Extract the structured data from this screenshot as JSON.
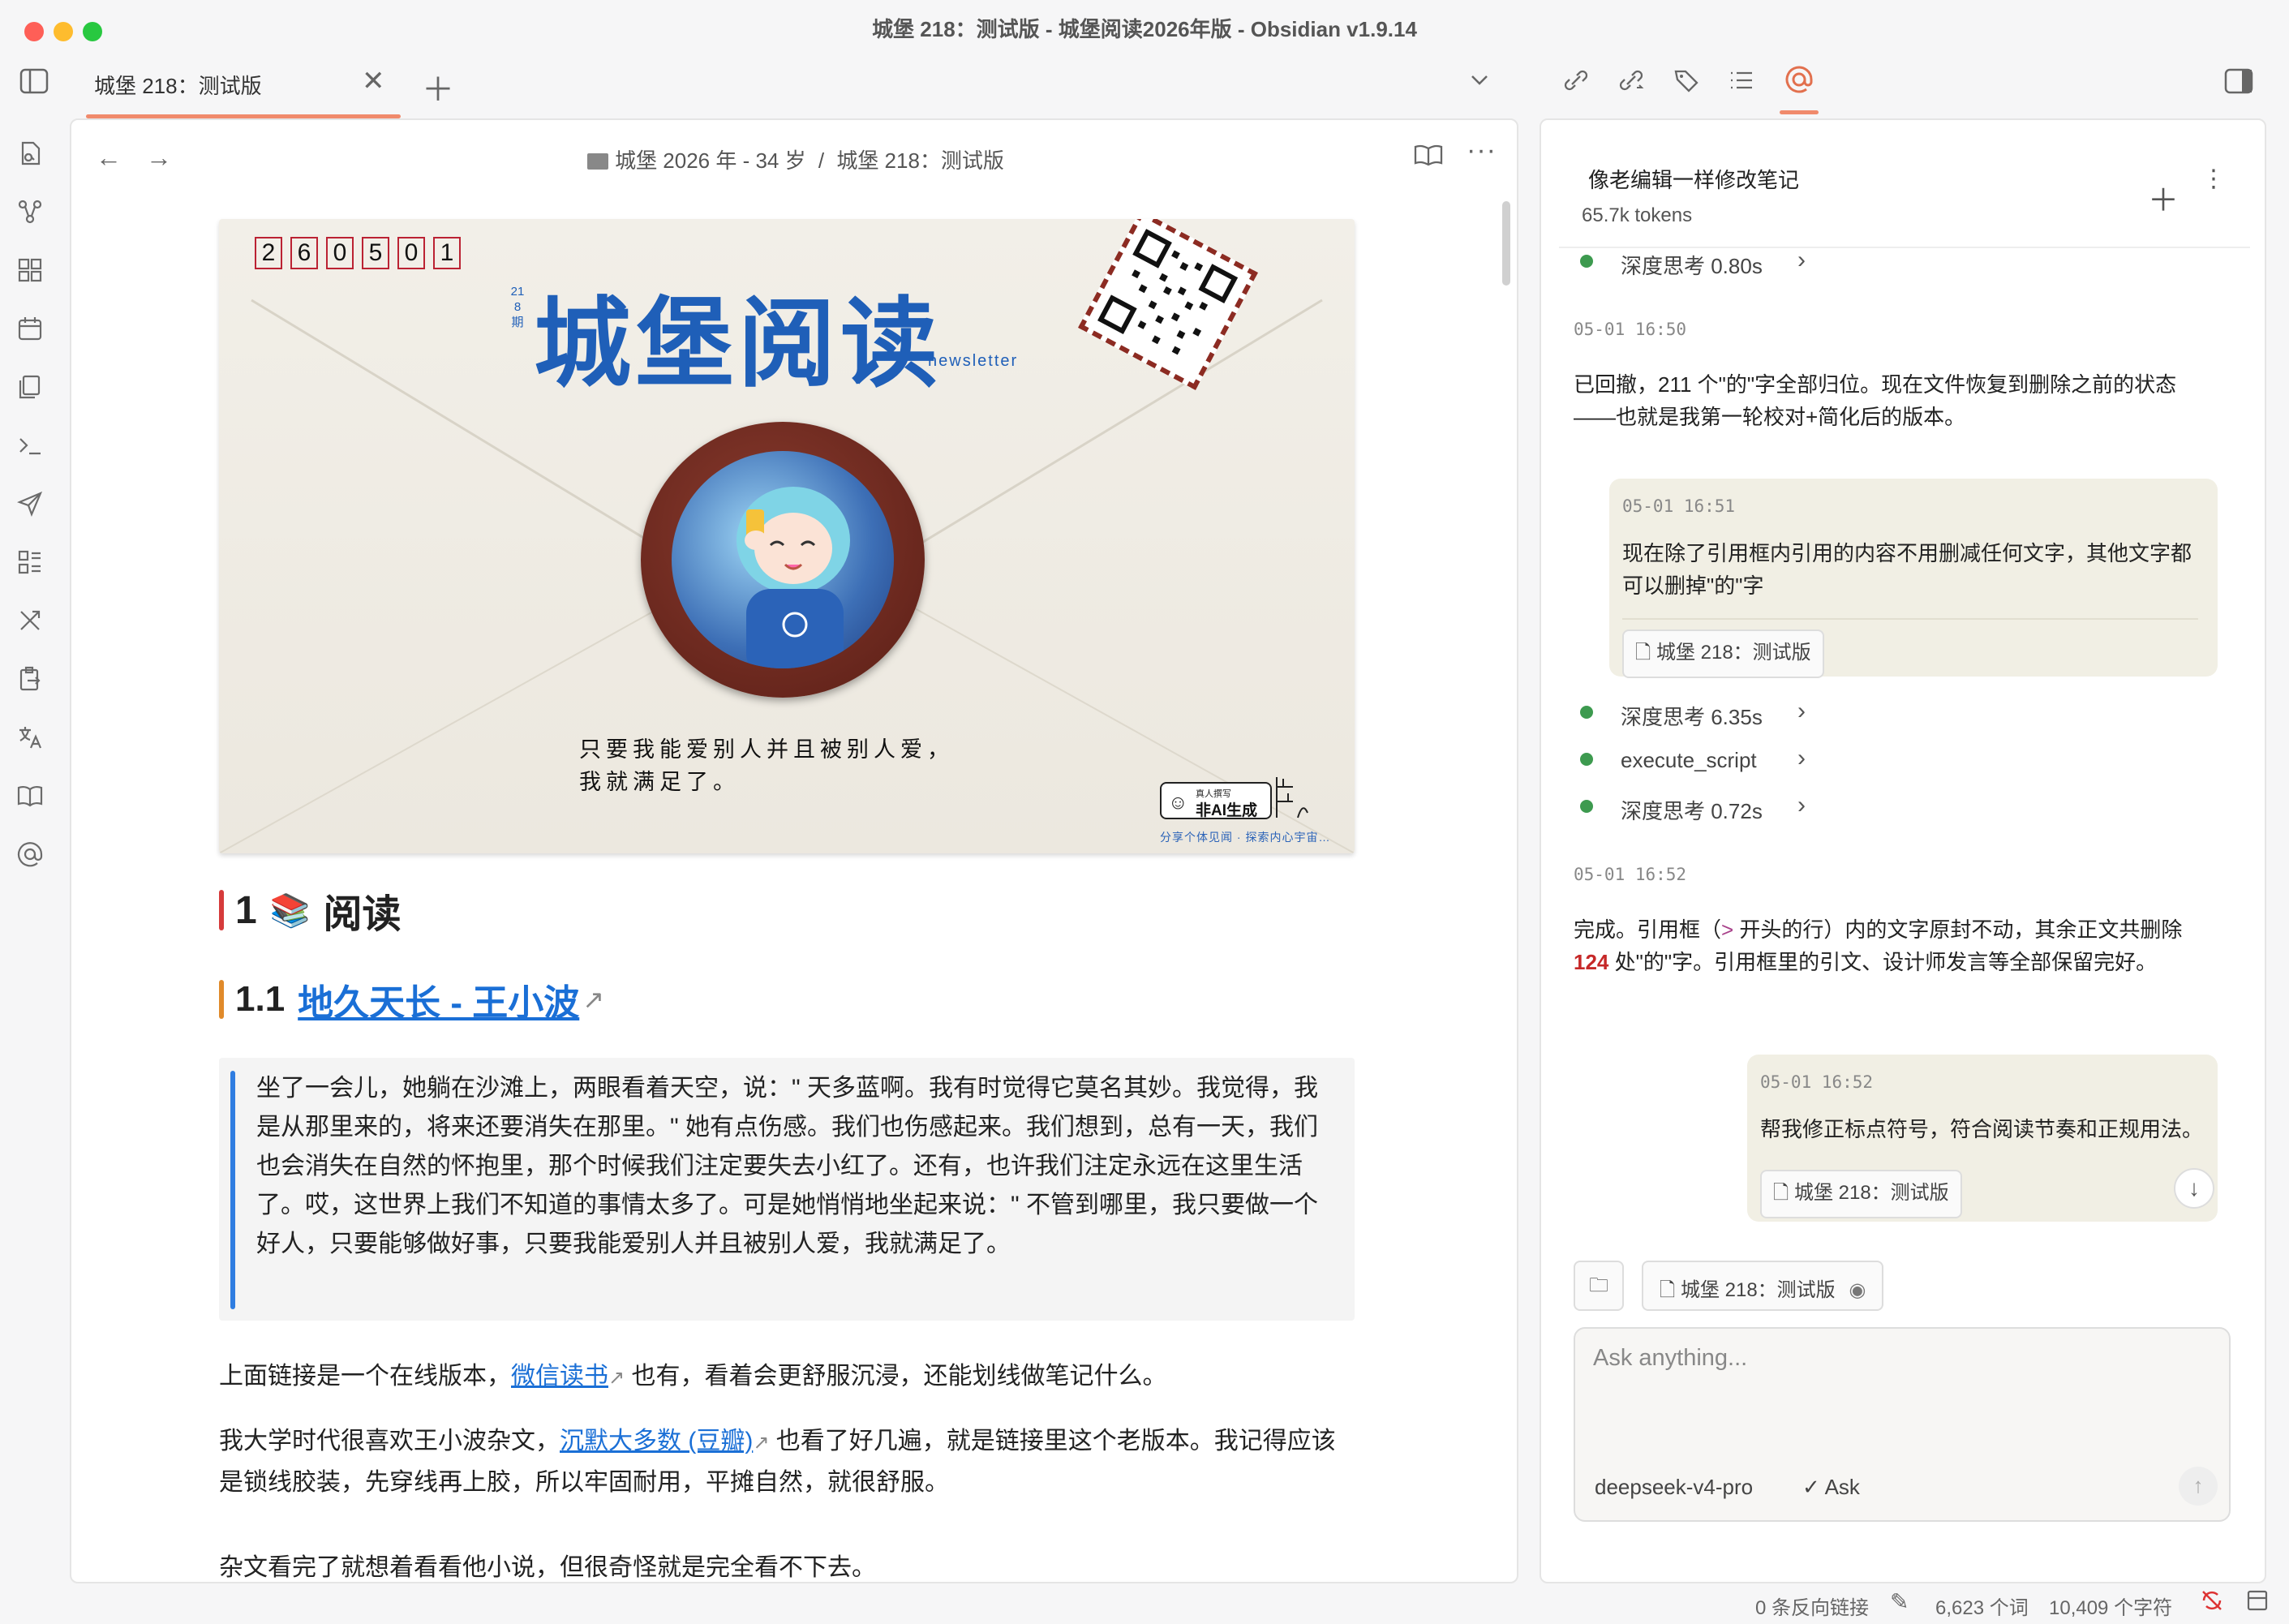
{
  "window": {
    "title": "城堡 218：测试版 - 城堡阅读2026年版 - Obsidian v1.9.14"
  },
  "tabs": [
    {
      "label": "城堡 218：测试版"
    }
  ],
  "breadcrumb": {
    "folder": "城堡 2026 年 - 34 岁",
    "separator": "/",
    "note": "城堡 218：测试版"
  },
  "hero": {
    "issue_digits": [
      "2",
      "6",
      "0",
      "5",
      "0",
      "1"
    ],
    "issue_vertical": "218期",
    "brand": "城堡阅读",
    "brand_sub": "newsletter",
    "caption_line1": "只要我能爱别人并且被别人爱，",
    "caption_line2": "我就满足了。",
    "badge_small": "真人撰写",
    "badge_big": "非AI生成",
    "footer_tagline": "分享个体见闻 · 探索内心宇宙…"
  },
  "content": {
    "h1_number": "1",
    "h1_emoji": "📚",
    "h1_title": "阅读",
    "h2_number": "1.1",
    "h2_link": "地久天长 - 王小波",
    "quote": "坐了一会儿，她躺在沙滩上，两眼看着天空，说：\" 天多蓝啊。我有时觉得它莫名其妙。我觉得，我是从那里来的，将来还要消失在那里。\" 她有点伤感。我们也伤感起来。我们想到，总有一天，我们也会消失在自然的怀抱里，那个时候我们注定要失去小红了。还有，也许我们注定永远在这里生活了。哎，这世界上我们不知道的事情太多了。可是她悄悄地坐起来说：\" 不管到哪里，我只要做一个好人，只要能够做好事，只要我能爱别人并且被别人爱，我就满足了。",
    "p1_before": "上面链接是一个在线版本，",
    "p1_link": "微信读书",
    "p1_after": " 也有，看着会更舒服沉浸，还能划线做笔记什么。",
    "p2_before": "我大学时代很喜欢王小波杂文，",
    "p2_link": "沉默大多数 (豆瓣)",
    "p2_after": " 也看了好几遍，就是链接里这个老版本。我记得应该是锁线胶装，先穿线再上胶，所以牢固耐用，平摊自然，就很舒服。",
    "p3": "杂文看完了就想着看看他小说，但很奇怪就是完全看不下去。"
  },
  "chat": {
    "title": "像老编辑一样修改笔记",
    "tokens": "65.7k tokens",
    "tool1": "深度思考 0.80s",
    "ts1": "05-01 16:50",
    "assistant1": "已回撤，211 个\"的\"字全部归位。现在文件恢复到删除之前的状态——也就是我第一轮校对+简化后的版本。",
    "user1_ts": "05-01 16:51",
    "user1_text": "现在除了引用框内引用的内容不用删减任何文字，其他文字都可以删掉\"的\"字",
    "user1_chip": "城堡 218：测试版",
    "tool2": "深度思考 6.35s",
    "tool3": "execute_script",
    "tool4": "深度思考 0.72s",
    "ts2": "05-01 16:52",
    "assistant2_a": "完成。引用框（",
    "assistant2_gt": ">",
    "assistant2_b": " 开头的行）内的文字原封不动，其余正文共删除 ",
    "assistant2_count": "124",
    "assistant2_c": " 处\"的\"字。引用框里的引文、设计师发言等全部保留完好。",
    "user2_ts": "05-01 16:52",
    "user2_text": "帮我修正标点符号，符合阅读节奏和正规用法。",
    "user2_chip": "城堡 218：测试版",
    "context_chip": "城堡 218：测试版",
    "input_placeholder": "Ask anything...",
    "model": "deepseek-v4-pro",
    "mode": "Ask"
  },
  "status": {
    "backlinks": "0 条反向链接",
    "words": "6,623 个词",
    "chars": "10,409 个字符"
  },
  "colors": {
    "accent": "#f08a6c",
    "link": "#1a6fd6",
    "tool_dot": "#3d9a4f",
    "brand_blue": "#1f5fb8",
    "h1_bar": "#d63b3b",
    "h2_bar": "#e08a2a",
    "count_red": "#c62828"
  }
}
